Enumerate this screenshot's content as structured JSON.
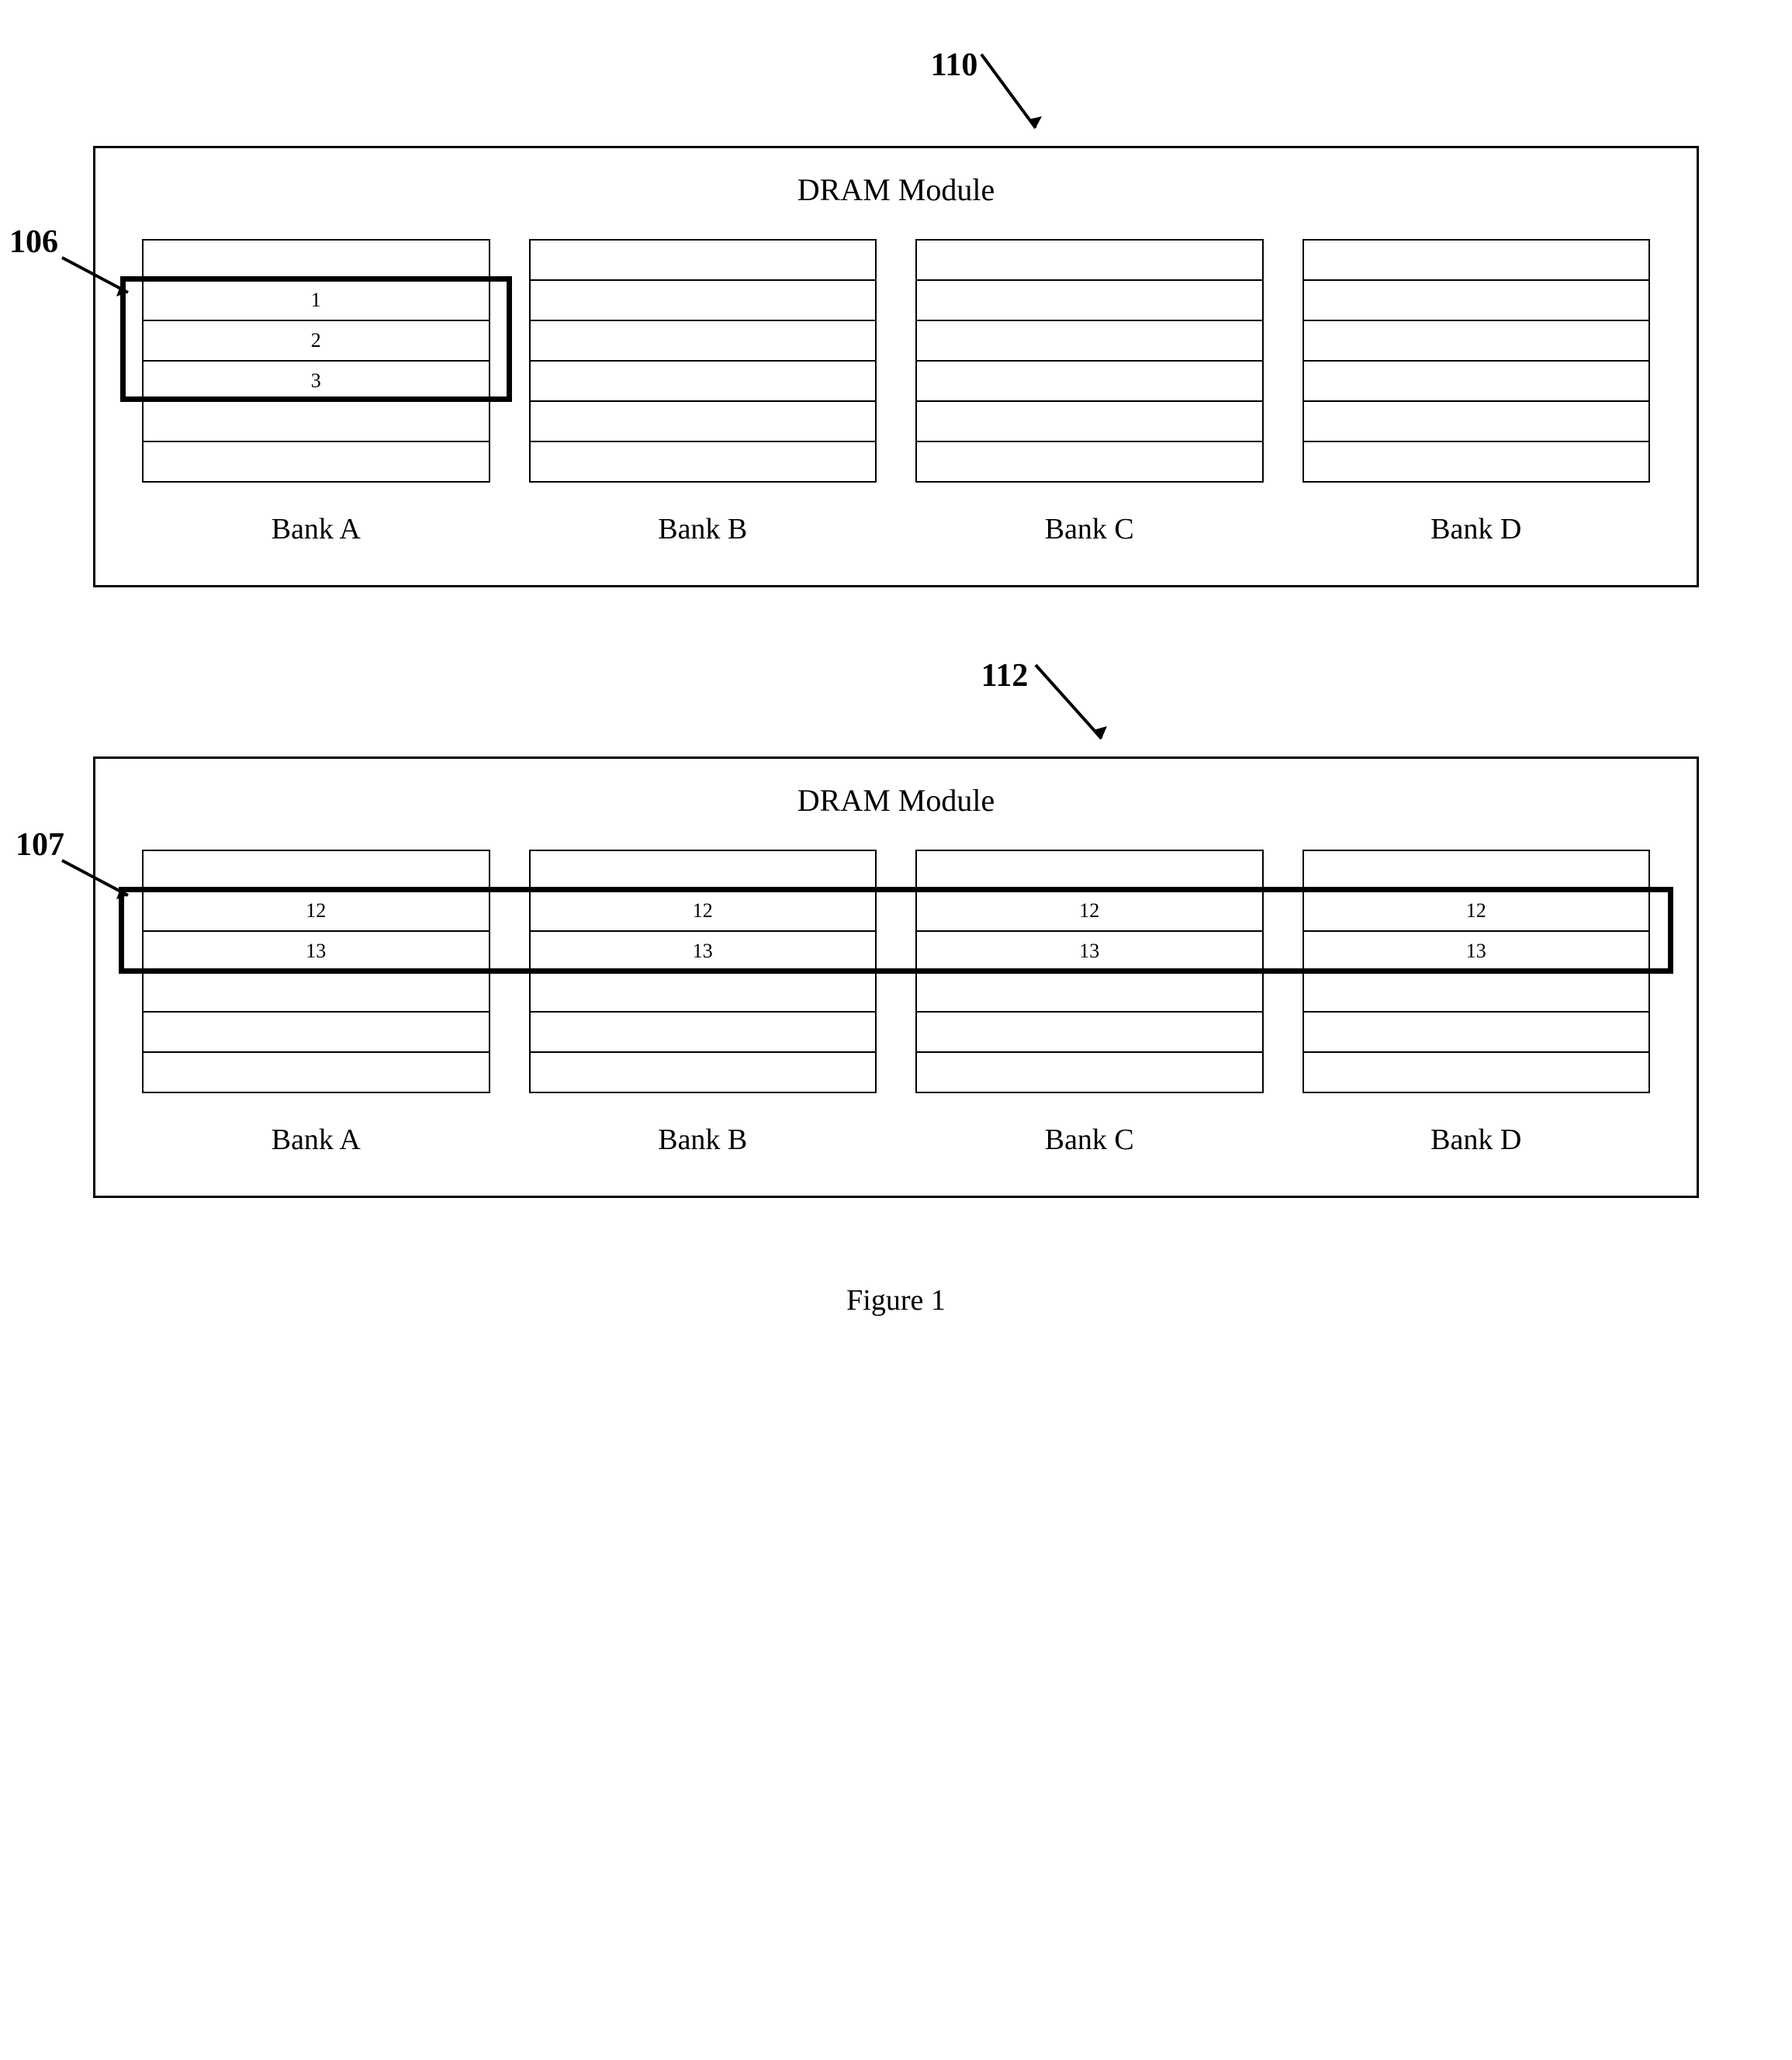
{
  "chart_data": {
    "type": "diagram",
    "modules": [
      {
        "id_label": "110",
        "side_label": "106",
        "title": "DRAM Module",
        "banks": [
          {
            "name": "Bank A",
            "rows": [
              "",
              "1",
              "2",
              "3",
              "",
              ""
            ]
          },
          {
            "name": "Bank B",
            "rows": [
              "",
              "",
              "",
              "",
              "",
              ""
            ]
          },
          {
            "name": "Bank C",
            "rows": [
              "",
              "",
              "",
              "",
              "",
              ""
            ]
          },
          {
            "name": "Bank D",
            "rows": [
              "",
              "",
              "",
              "",
              "",
              ""
            ]
          }
        ],
        "highlight": {
          "bank_span": [
            0,
            0
          ],
          "row_start": 1,
          "row_end": 3,
          "description": "Rows 1,2,3 of Bank A"
        }
      },
      {
        "id_label": "112",
        "side_label": "107",
        "title": "DRAM Module",
        "banks": [
          {
            "name": "Bank A",
            "rows": [
              "",
              "12",
              "13",
              "",
              "",
              ""
            ]
          },
          {
            "name": "Bank B",
            "rows": [
              "",
              "12",
              "13",
              "",
              "",
              ""
            ]
          },
          {
            "name": "Bank C",
            "rows": [
              "",
              "12",
              "13",
              "",
              "",
              ""
            ]
          },
          {
            "name": "Bank D",
            "rows": [
              "",
              "12",
              "13",
              "",
              "",
              ""
            ]
          }
        ],
        "highlight": {
          "bank_span": [
            0,
            3
          ],
          "row_start": 1,
          "row_end": 2,
          "description": "Rows 12,13 across all banks"
        }
      }
    ],
    "caption": "Figure 1"
  }
}
